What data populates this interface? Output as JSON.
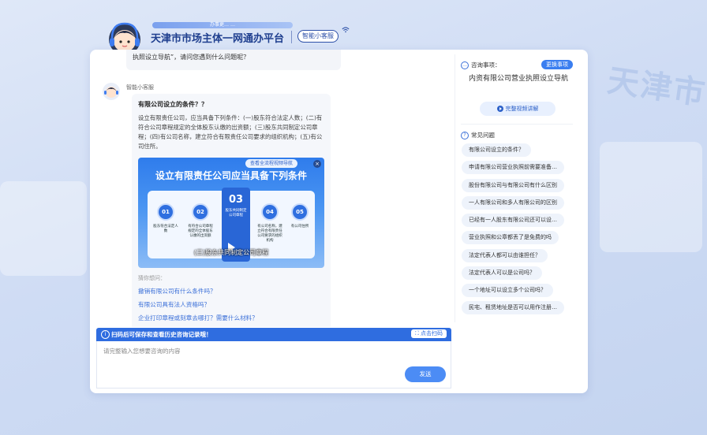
{
  "header": {
    "slogan": "办事更…  …",
    "title": "天津市市场主体一网通办平台",
    "service_badge": "智能小客服"
  },
  "background": {
    "watermark": "天津市"
  },
  "chat": {
    "previous_message": "执照设立导航”，请问您遇到什么问题呢？",
    "bot_name": "智能小客服",
    "answer": {
      "question": "有限公司设立的条件？？",
      "body": "设立有限责任公司，应当具备下列条件：(一)股东符合法定人数；(二)有符合公司章程规定的全体股东认缴的出资额；(三)股东共同制定公司章程；(四)有公司名称，建立符合有限责任公司要求的组织机构；(五)有公司住所。",
      "video": {
        "tag": "查看全流程视频导航",
        "close": "×",
        "heading": "设立有限责任公司应当具备下列条件",
        "steps": [
          {
            "num": "01",
            "text": "股东符合法定人数"
          },
          {
            "num": "02",
            "text": "有符合公司章程规定的全体股东认缴的出资额"
          },
          {
            "num": "03",
            "text": "股东共同制定公司章程"
          },
          {
            "num": "04",
            "text": "有公司名称，建立符合有限责任公司要求的组织机构"
          },
          {
            "num": "05",
            "text": "有公司住所"
          }
        ],
        "subtitle": "(三)股东共同制定公司章程"
      },
      "guess_label": "猜你想问：",
      "guesses": [
        "撤销有限公司有什么条件吗？",
        "有限公司具有法人资格吗？",
        "企业打印章程或刻章去哪打？需要什么材料？"
      ]
    }
  },
  "notice": {
    "icon": "i",
    "text": "扫码后可保存和查看历史咨询记录哦！",
    "scan_button": "点击扫码"
  },
  "input": {
    "placeholder": "请完整输入您想要咨询的内容",
    "send": "发送"
  },
  "sidebar": {
    "consult_title": "咨询事项：",
    "change_button": "更换事项",
    "consult_item": "内资有限公司营业执照设立导航",
    "video_detail": "完整视频讲解",
    "faq_title": "常见问题",
    "faqs": [
      "有限公司设立的条件？",
      "申请有限公司营业执照前需要准备…",
      "股份有限公司与有限公司有什么区别",
      "一人有限公司和多人有限公司的区别",
      "已经有一人股东有限公司还可以设…",
      "营业执照和公章都丢了是免费的吗",
      "法定代表人都可以由谁担任？",
      "法定代表人可以是公司吗？",
      "一个地址可以设立多个公司吗？",
      "民宅、租赁地址是否可以用作注册…"
    ]
  }
}
